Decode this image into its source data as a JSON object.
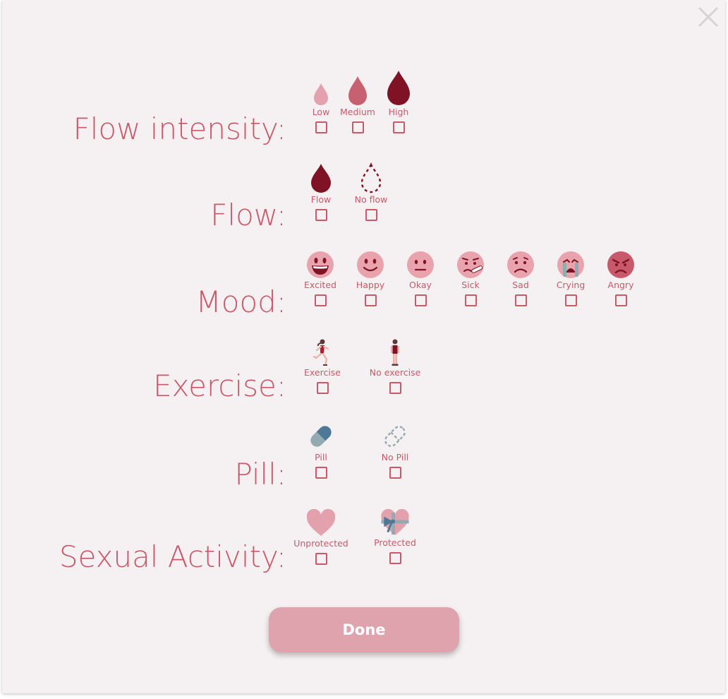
{
  "close": {
    "icon": "close-icon"
  },
  "sections": {
    "flow_intensity": {
      "label": "Flow intensity:",
      "options": [
        {
          "label": "Low",
          "icon": "drop-light-icon"
        },
        {
          "label": "Medium",
          "icon": "drop-medium-icon"
        },
        {
          "label": "High",
          "icon": "drop-dark-icon"
        }
      ]
    },
    "flow": {
      "label": "Flow:",
      "options": [
        {
          "label": "Flow",
          "icon": "drop-dark-icon"
        },
        {
          "label": "No flow",
          "icon": "drop-dashed-icon"
        }
      ]
    },
    "mood": {
      "label": "Mood:",
      "options": [
        {
          "label": "Excited",
          "icon": "excited-face-icon"
        },
        {
          "label": "Happy",
          "icon": "happy-face-icon"
        },
        {
          "label": "Okay",
          "icon": "okay-face-icon"
        },
        {
          "label": "Sick",
          "icon": "sick-face-icon"
        },
        {
          "label": "Sad",
          "icon": "sad-face-icon"
        },
        {
          "label": "Crying",
          "icon": "crying-face-icon"
        },
        {
          "label": "Angry",
          "icon": "angry-face-icon"
        }
      ]
    },
    "exercise": {
      "label": "Exercise:",
      "options": [
        {
          "label": "Exercise",
          "icon": "running-person-icon"
        },
        {
          "label": "No exercise",
          "icon": "standing-person-icon"
        }
      ]
    },
    "pill": {
      "label": "Pill:",
      "options": [
        {
          "label": "Pill",
          "icon": "pill-icon"
        },
        {
          "label": "No Pill",
          "icon": "pill-dashed-icon"
        }
      ]
    },
    "sexual_activity": {
      "label": "Sexual Activity:",
      "options": [
        {
          "label": "Unprotected",
          "icon": "heart-icon"
        },
        {
          "label": "Protected",
          "icon": "wrapped-heart-icon"
        }
      ]
    }
  },
  "done_label": "Done",
  "colors": {
    "accent": "#c8596a",
    "background": "#f5f0f1",
    "drop_light": "#e3a1ad",
    "drop_medium": "#c8616f",
    "drop_dark": "#7f1325",
    "face_fill": "#e8a3ad",
    "angry_fill": "#c8596a",
    "pill_blue": "#4f7896",
    "pill_grey": "#93aab0",
    "button": "#dfa3ae"
  }
}
